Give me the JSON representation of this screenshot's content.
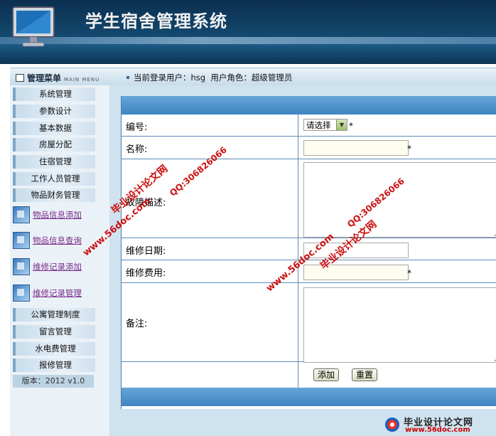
{
  "header": {
    "title": "学生宿舍管理系统"
  },
  "topbar": {
    "menu_title": "管理菜单",
    "menu_subtitle": "MAIN MENU",
    "user_label": "当前登录用户：",
    "user_name": "hsg",
    "role_label": "用户角色：",
    "role_name": "超级管理员"
  },
  "sidebar": {
    "items": [
      {
        "label": "系统管理"
      },
      {
        "label": "参数设计"
      },
      {
        "label": "基本数据"
      },
      {
        "label": "房屋分配"
      },
      {
        "label": "住宿管理"
      },
      {
        "label": "工作人员管理"
      },
      {
        "label": "物品财务管理"
      }
    ],
    "sub_items": [
      {
        "label": "物品信息添加"
      },
      {
        "label": "物品信息查询"
      },
      {
        "label": "维修记录添加"
      },
      {
        "label": "维修记录管理"
      }
    ],
    "items_after": [
      {
        "label": "公寓管理制度"
      },
      {
        "label": "留言管理"
      },
      {
        "label": "水电费管理"
      },
      {
        "label": "报修管理"
      }
    ],
    "version": "版本：2012 v1.0"
  },
  "form": {
    "fields": {
      "number": {
        "label": "编号:",
        "select_value": "请选择",
        "required_mark": "*"
      },
      "name": {
        "label": "名称:",
        "value": "",
        "required_mark": "*"
      },
      "damage": {
        "label": "故障描述:",
        "value": ""
      },
      "repair_date": {
        "label": "维修日期:",
        "value": ""
      },
      "repair_cost": {
        "label": "维修费用:",
        "value": "",
        "required_mark": "*"
      },
      "remarks": {
        "label": "备注:",
        "value": ""
      }
    },
    "buttons": {
      "add": "添加",
      "reset": "重置"
    }
  },
  "watermarks": {
    "brand": "毕业设计论文网",
    "url": "www.56doc.com",
    "qq": "QQ:306826066",
    "footer_brand": "毕业设计论文网",
    "footer_url": "www.56doc.com"
  },
  "colors": {
    "header_bg": "#14486e",
    "form_band": "#4a8fc8",
    "sidebar_bg": "#eaf2f8",
    "link": "#7a2a8a",
    "watermark": "#cc1010"
  }
}
